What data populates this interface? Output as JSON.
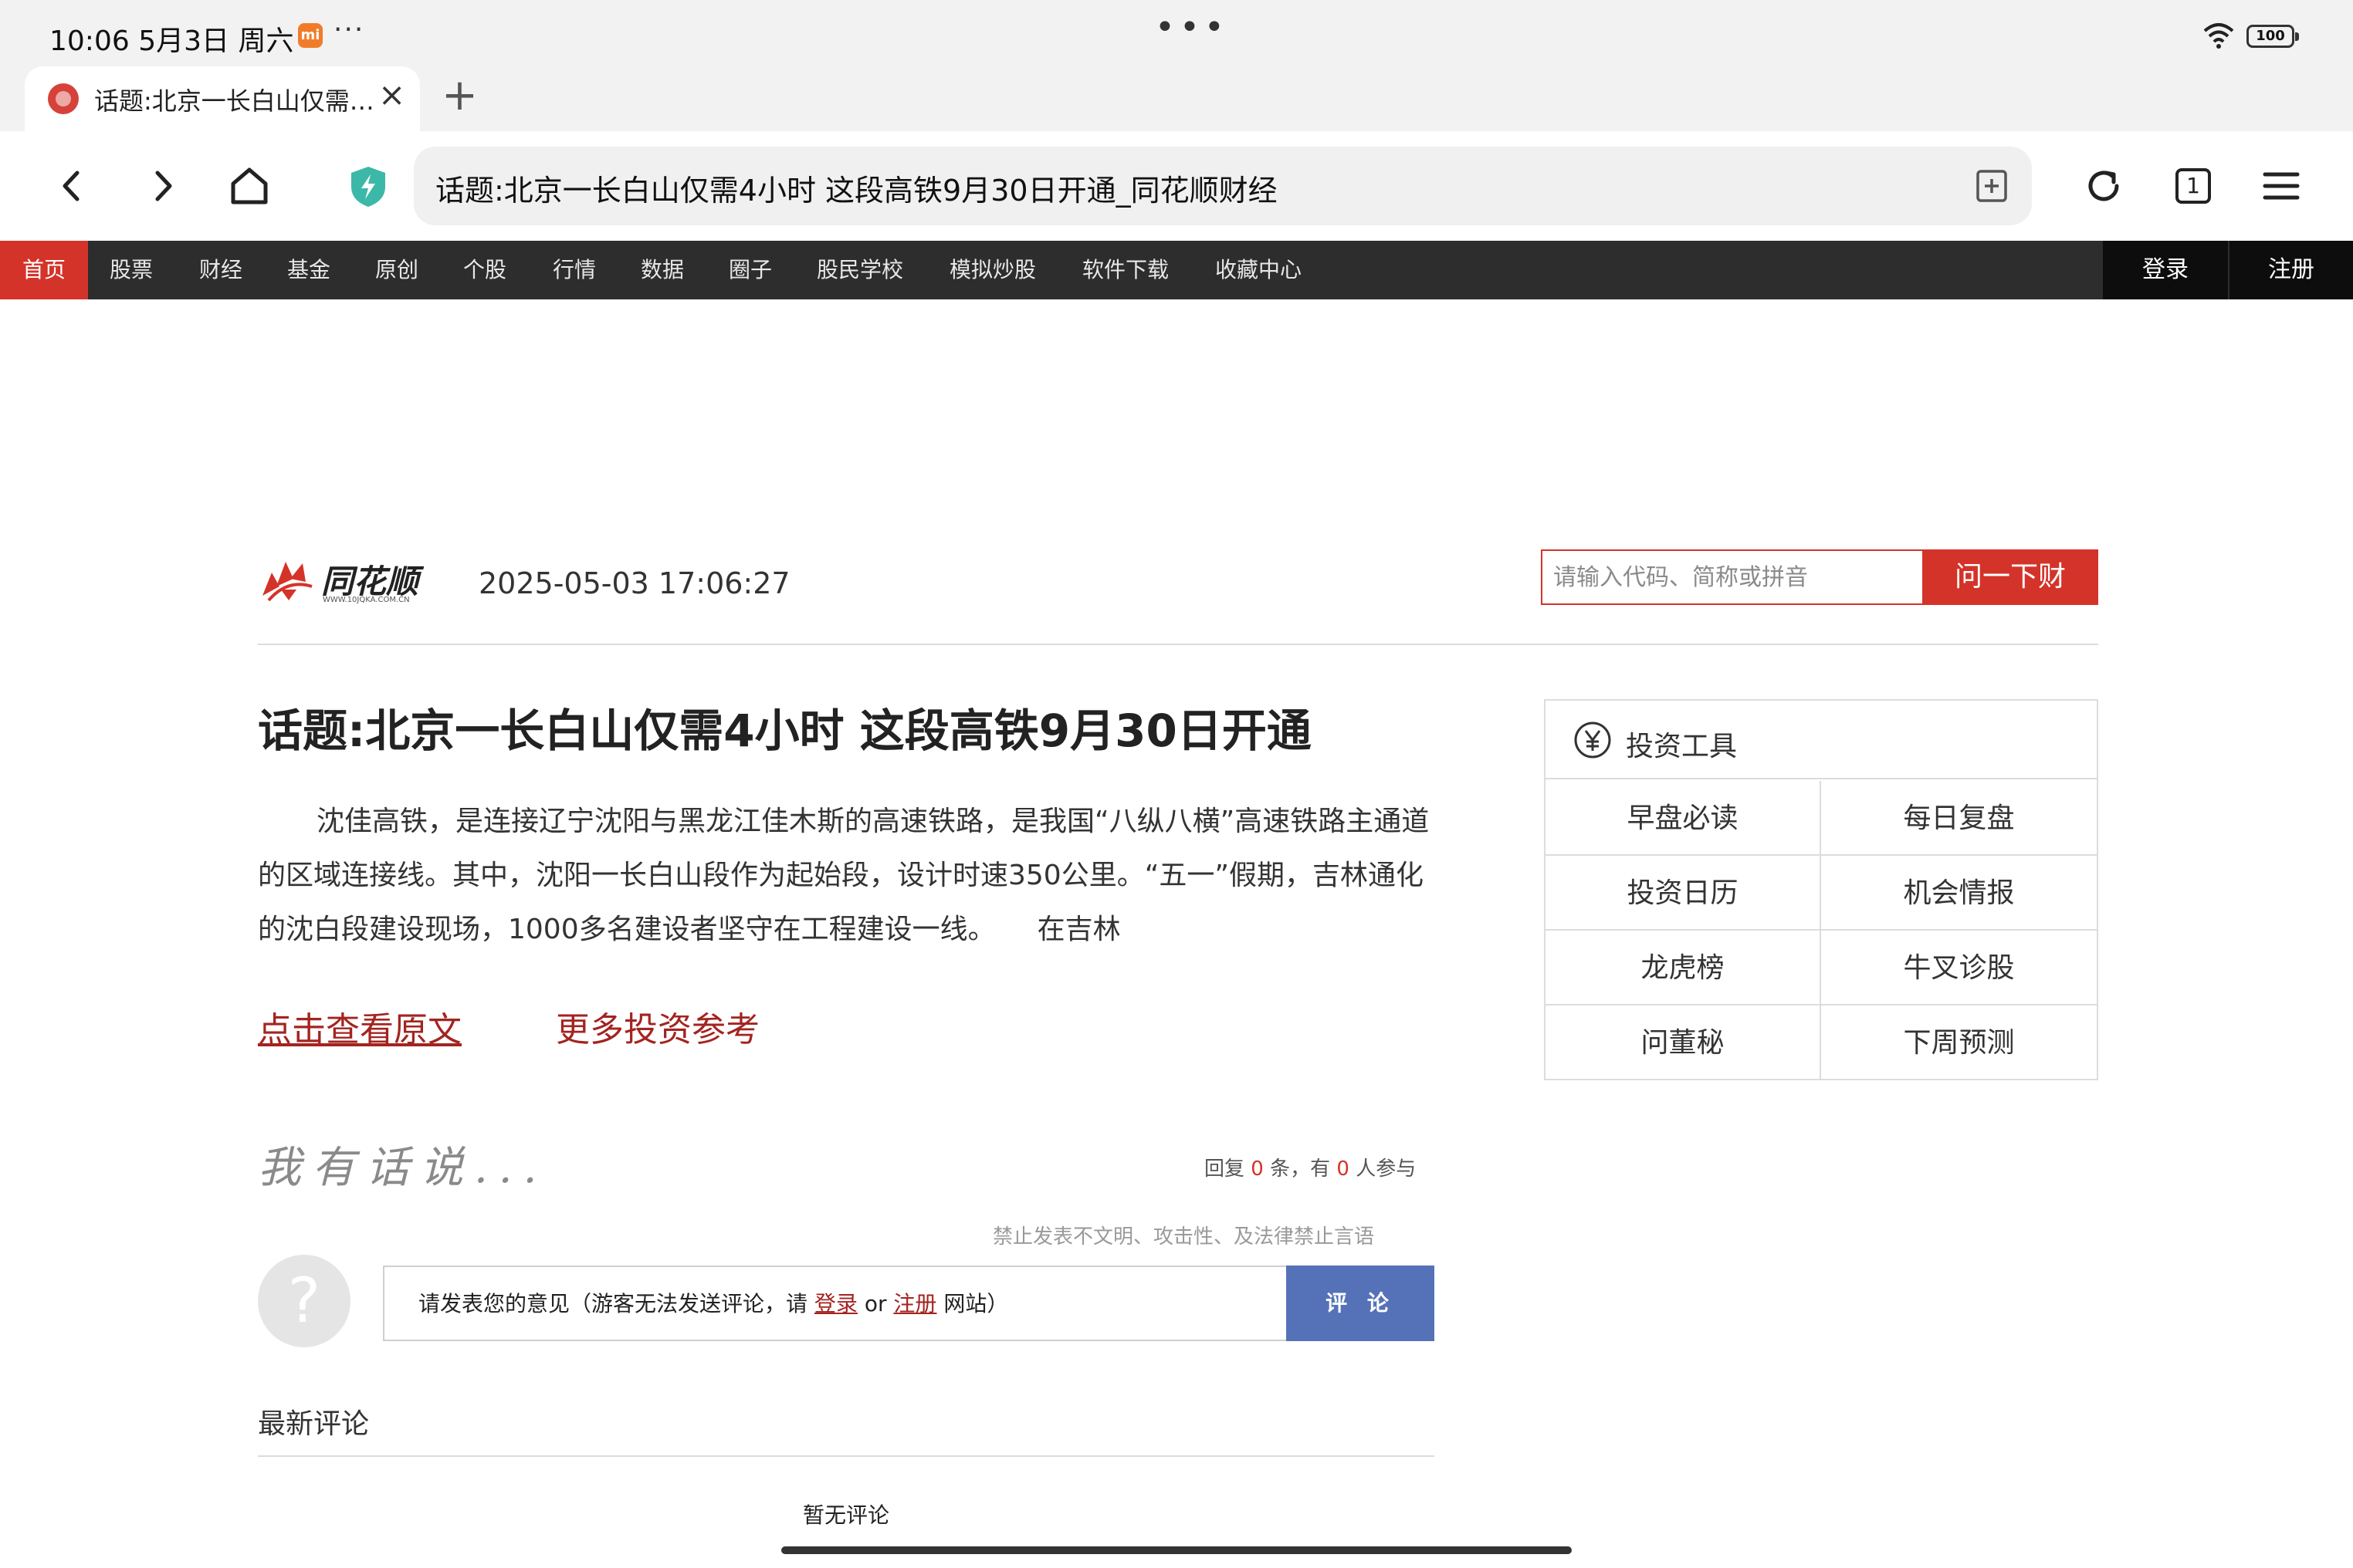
{
  "status_bar": {
    "time": "10:06  5月3日 周六",
    "mi_badge": "mi",
    "more": "···",
    "center_dots": "•••",
    "battery": "100"
  },
  "tab": {
    "title": "话题:北京一长白山仅需4小时 这段高铁9月30日开通_同花顺财经",
    "close": "×",
    "new_tab": "+"
  },
  "toolbar": {
    "url_text": "话题:北京一长白山仅需4小时 这段高铁9月30日开通_同花顺财经",
    "tabs_count": "1"
  },
  "site_nav": {
    "items": [
      "首页",
      "股票",
      "财经",
      "基金",
      "原创",
      "个股",
      "行情",
      "数据",
      "圈子",
      "股民学校",
      "模拟炒股",
      "软件下载",
      "收藏中心"
    ],
    "active": "首页",
    "login": "登录",
    "register": "注册"
  },
  "header": {
    "logo_text": "同花顺",
    "logo_url": "WWW.10JQKA.COM.CN",
    "date": "2025-05-03 17:06:27",
    "search_placeholder": "请输入代码、简称或拼音",
    "search_button": "问一下财"
  },
  "article": {
    "title": "话题:北京一长白山仅需4小时 这段高铁9月30日开通",
    "body": "沈佳高铁，是连接辽宁沈阳与黑龙江佳木斯的高速铁路，是我国“八纵八横”高速铁路主通道的区域连接线。其中，沈阳一长白山段作为起始段，设计时速350公里。“五一”假期，吉林通化的沈白段建设现场，1000多名建设者坚守在工程建设一线。　　在吉林",
    "link_original": "点击查看原文",
    "link_more": "更多投资参考"
  },
  "tools": {
    "title": "投资工具",
    "items": [
      "早盘必读",
      "每日复盘",
      "投资日历",
      "机会情报",
      "龙虎榜",
      "牛叉诊股",
      "问董秘",
      "下周预测"
    ]
  },
  "comments": {
    "heading": "我有话说...",
    "stats_prefix": "回复",
    "reply_count": "0",
    "stats_mid": "条，有",
    "people_count": "0",
    "stats_suffix": "人参与",
    "forbid_notice": "禁止发表不文明、攻击性、及法律禁止言语",
    "avatar_mark": "?",
    "input_prefix": "请发表您的意见（游客无法发送评论，请",
    "input_login": "登录",
    "input_or": "or",
    "input_register": "注册",
    "input_suffix": "网站）",
    "submit": "评 论",
    "latest_title": "最新评论",
    "empty": "暂无评论"
  }
}
